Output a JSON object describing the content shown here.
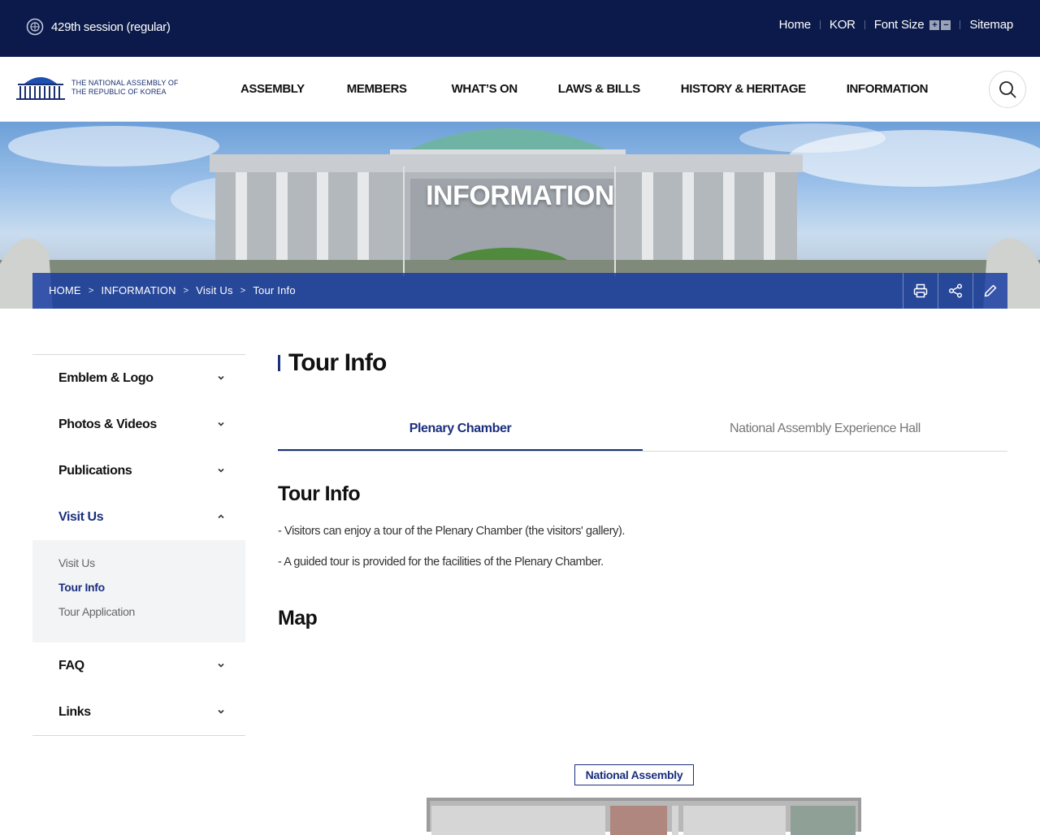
{
  "topbar": {
    "session": "429th session (regular)",
    "links": {
      "home": "Home",
      "kor": "KOR",
      "font_size": "Font Size",
      "sitemap": "Sitemap"
    }
  },
  "header": {
    "logo_line1": "THE NATIONAL ASSEMBLY OF",
    "logo_line2": "THE REPUBLIC OF KOREA",
    "nav": [
      "ASSEMBLY",
      "MEMBERS",
      "WHAT’S ON",
      "LAWS & BILLS",
      "HISTORY & HERITAGE",
      "INFORMATION"
    ]
  },
  "hero": {
    "title": "INFORMATION",
    "breadcrumb": [
      "HOME",
      "INFORMATION",
      "Visit Us",
      "Tour Info"
    ]
  },
  "sidebar": {
    "items": [
      {
        "label": "Emblem & Logo"
      },
      {
        "label": "Photos & Videos"
      },
      {
        "label": "Publications"
      },
      {
        "label": "Visit Us"
      },
      {
        "label": "FAQ"
      },
      {
        "label": "Links"
      }
    ],
    "sub": [
      "Visit Us",
      "Tour Info",
      "Tour Application"
    ]
  },
  "content": {
    "page_title": "Tour Info",
    "tabs": [
      "Plenary Chamber",
      "National Assembly Experience Hall"
    ],
    "section1_title": "Tour Info",
    "lines": [
      "- Visitors can enjoy a tour of the Plenary Chamber (the visitors' gallery).",
      "- A guided tour is provided for the facilities of the Plenary Chamber."
    ],
    "section2_title": "Map",
    "map_label": "National Assembly"
  },
  "colors": {
    "topbar": "#0b1a4a",
    "accent": "#1a2f7e",
    "breadcrumb_bar": "#1438a0"
  }
}
